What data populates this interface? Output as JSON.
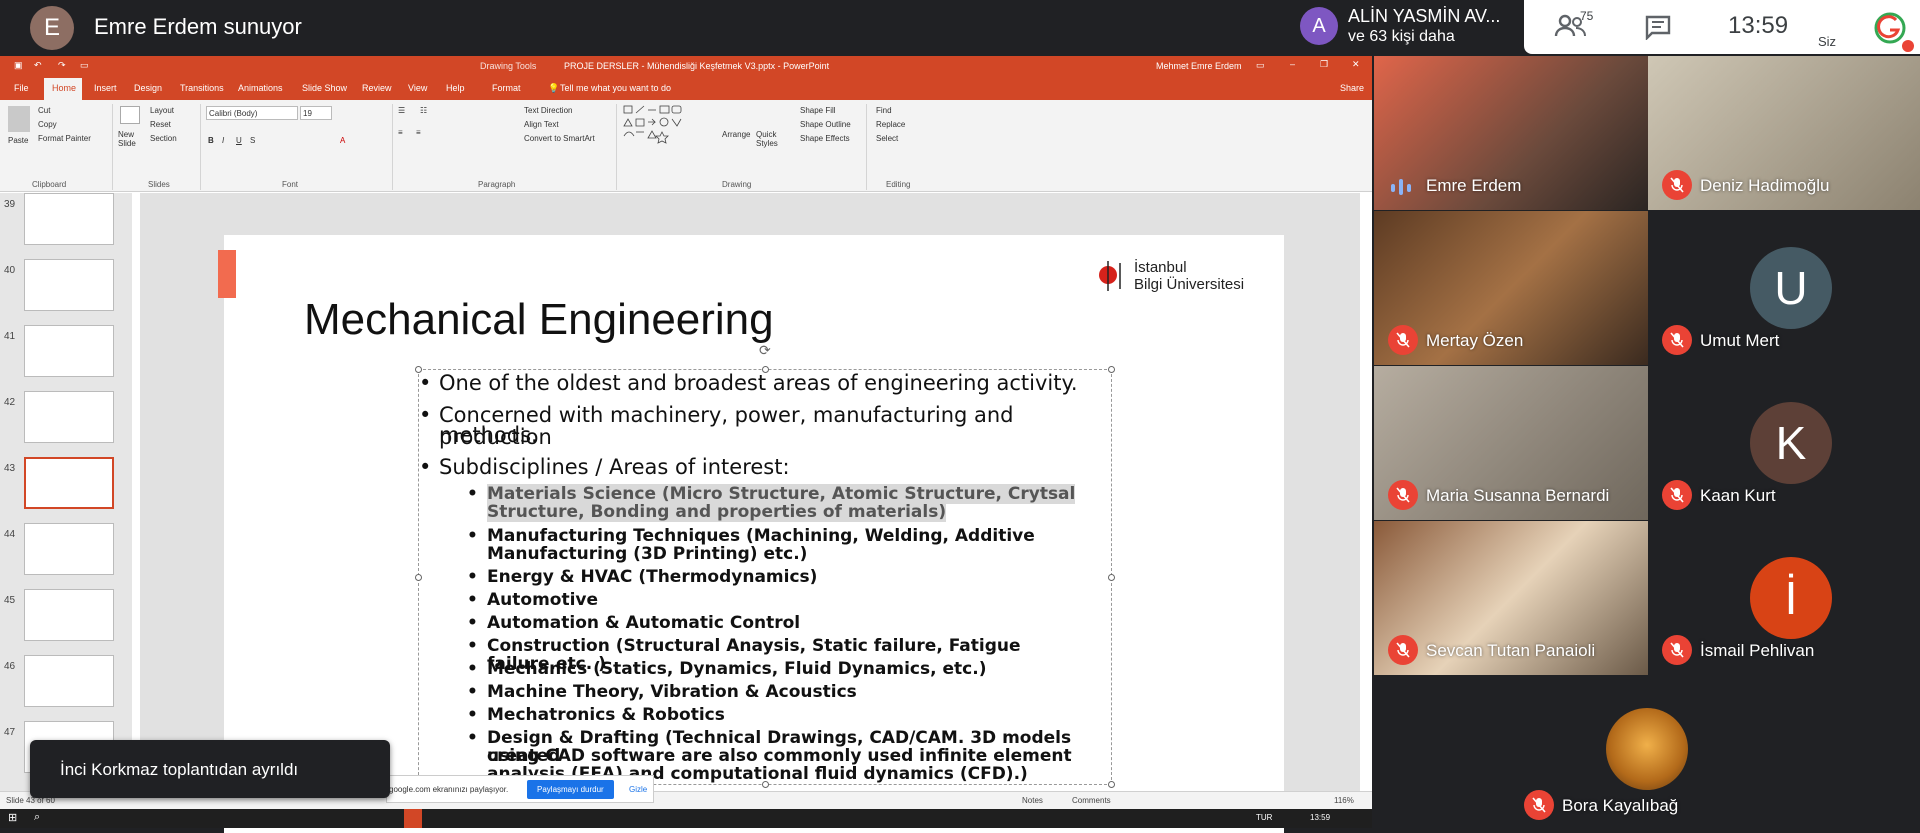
{
  "meet": {
    "presenter_initial": "E",
    "presenter_label": "Emre Erdem sunuyor",
    "attendee_initial": "A",
    "attendee_name": "ALİN YASMİN AV...",
    "attendee_more": "ve 63 kişi daha",
    "people_count": "75",
    "clock": "13:59",
    "self_label": "Siz",
    "toast": "İnci Korkmaz toplantıdan ayrıldı",
    "share_text": "google.com ekranınızı paylaşıyor.",
    "stop_share": "Paylaşmayı durdur",
    "hide": "Gizle"
  },
  "ppt": {
    "drawing_tools": "Drawing Tools",
    "window_title": "PROJE DERSLER - Mühendisliği Keşfetmek V3.pptx  -  PowerPoint",
    "user": "Mehmet Emre Erdem",
    "tabs": [
      "File",
      "Home",
      "Insert",
      "Design",
      "Transitions",
      "Animations",
      "Slide Show",
      "Review",
      "View",
      "Help",
      "Format"
    ],
    "tell_me": "Tell me what you want to do",
    "share": "Share",
    "ribbon": {
      "paste": "Paste",
      "cut": "Cut",
      "copy": "Copy",
      "format_painter": "Format Painter",
      "clipboard": "Clipboard",
      "new_slide": "New Slide",
      "layout": "Layout",
      "reset": "Reset",
      "section": "Section",
      "slides": "Slides",
      "font_name": "Calibri (Body)",
      "font_size": "19",
      "font": "Font",
      "paragraph": "Paragraph",
      "text_direction": "Text Direction",
      "align_text": "Align Text",
      "convert_smartart": "Convert to SmartArt",
      "arrange": "Arrange",
      "quick_styles": "Quick Styles",
      "shape_fill": "Shape Fill",
      "shape_outline": "Shape Outline",
      "shape_effects": "Shape Effects",
      "drawing": "Drawing",
      "find": "Find",
      "replace": "Replace",
      "select": "Select",
      "editing": "Editing"
    },
    "thumb_numbers": [
      "39",
      "40",
      "41",
      "42",
      "43",
      "44",
      "45",
      "46",
      "47"
    ],
    "status_slide": "Slide 43 of 60",
    "notes": "Notes",
    "comments": "Comments",
    "zoom": "116%",
    "taskbar_lang": "TUR",
    "taskbar_time": "13:59"
  },
  "slide": {
    "title": "Mechanical Engineering",
    "logo_line1": "İstanbul",
    "logo_line2": "Bilgi Üniversitesi",
    "bullets": [
      "One of the oldest and broadest areas of engineering activity.",
      "Concerned with machinery, power, manufacturing and production",
      "methods.",
      "Subdisciplines / Areas of interest:"
    ],
    "sub": [
      "Materials Science (Micro Structure, Atomic Structure, Crytsal",
      "Structure, Bonding and properties of materials)",
      "Manufacturing Techniques (Machining, Welding, Additive",
      "Manufacturing (3D Printing) etc.)",
      "Energy & HVAC (Thermodynamics)",
      "Automotive",
      "Automation & Automatic Control",
      "Construction (Structural Anaysis, Static failure, Fatigue failure,etc. )",
      "Mechanics (Statics, Dynamics, Fluid Dynamics, etc.)",
      "Machine Theory, Vibration & Acoustics",
      "Mechatronics & Robotics",
      "Design & Drafting (Technical Drawings, CAD/CAM. 3D models created",
      "using CAD software are also commonly used infinite element",
      "analysis (FEA) and computational fluid dynamics (CFD).)"
    ]
  },
  "participants": [
    {
      "name": "Emre Erdem"
    },
    {
      "name": "Deniz Hadimoğlu"
    },
    {
      "name": "Mertay Özen"
    },
    {
      "name": "Umut Mert",
      "initial": "U",
      "color": "#455a64"
    },
    {
      "name": "Maria Susanna Bernardi"
    },
    {
      "name": "Kaan Kurt",
      "initial": "K",
      "color": "#5d4037"
    },
    {
      "name": "Sevcan Tutan Panaioli"
    },
    {
      "name": "İsmail Pehlivan",
      "initial": "İ",
      "color": "#d84315"
    },
    {
      "name": "Bora Kayalıbağ"
    }
  ],
  "colors": {
    "ppt_accent": "#d24726",
    "mute_red": "#ea4335",
    "meet_bg": "#202124"
  }
}
